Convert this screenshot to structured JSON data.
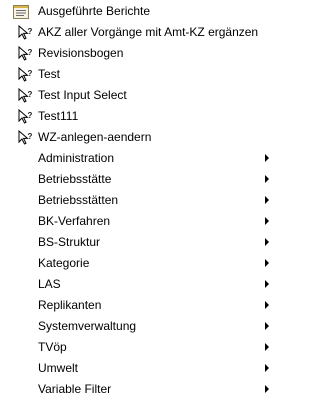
{
  "menu": {
    "report_items": [
      {
        "label": "Ausgeführte Berichte",
        "icon": "report-list-icon"
      },
      {
        "label": "AKZ aller Vorgänge mit Amt-KZ ergänzen",
        "icon": "query-cursor-icon"
      },
      {
        "label": "Revisionsbogen",
        "icon": "query-cursor-icon"
      },
      {
        "label": "Test",
        "icon": "query-cursor-icon"
      },
      {
        "label": "Test Input Select",
        "icon": "query-cursor-icon"
      },
      {
        "label": "Test111",
        "icon": "query-cursor-icon"
      },
      {
        "label": "WZ-anlegen-aendern",
        "icon": "query-cursor-icon"
      }
    ],
    "folders": [
      "Administration",
      "Betriebsstätte",
      "Betriebsstätten",
      "BK-Verfahren",
      "BS-Struktur",
      "Kategorie",
      "LAS",
      "Replikanten",
      "Systemverwaltung",
      "TVöp",
      "Umwelt",
      "Variable Filter"
    ]
  }
}
